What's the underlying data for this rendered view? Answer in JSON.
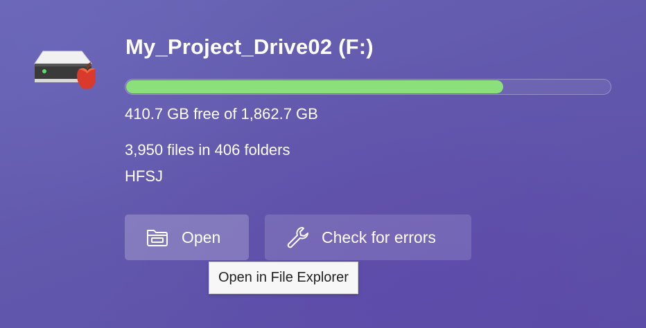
{
  "drive": {
    "title": "My_Project_Drive02 (F:)",
    "icon": "hard-drive-mac-icon",
    "usage_fraction": 0.78,
    "free_text": "410.7 GB free of 1,862.7 GB",
    "files_text": "3,950 files in 406 folders",
    "file_system": "HFSJ"
  },
  "actions": {
    "open_label": "Open",
    "open_icon": "folder-open-icon",
    "check_label": "Check for errors",
    "check_icon": "wrench-icon"
  },
  "tooltip": {
    "text": "Open in File Explorer"
  },
  "colors": {
    "usage_fill": "#8be07b",
    "background": "#6259ad"
  }
}
